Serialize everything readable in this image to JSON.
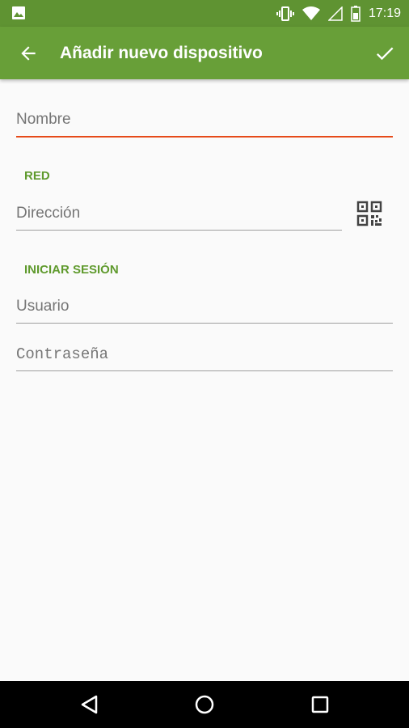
{
  "status_bar": {
    "time": "17:19",
    "icons": [
      "image-icon",
      "vibrate-icon",
      "wifi-icon",
      "signal-icon",
      "battery-icon"
    ]
  },
  "app_bar": {
    "title": "Añadir nuevo dispositivo",
    "back_icon": "arrow-back-icon",
    "confirm_icon": "check-icon"
  },
  "form": {
    "name_placeholder": "Nombre",
    "network_section": "RED",
    "address_placeholder": "Dirección",
    "qr_icon": "qr-code-icon",
    "login_section": "INICIAR SESIÓN",
    "user_placeholder": "Usuario",
    "password_placeholder": "Contraseña"
  },
  "nav_bar": {
    "icons": [
      "back-triangle-icon",
      "home-circle-icon",
      "recents-square-icon"
    ]
  },
  "colors": {
    "app_bar": "#689f38",
    "status_bar": "#5f9332",
    "section_text": "#5f9a2d",
    "focus_underline": "#e64a19"
  }
}
